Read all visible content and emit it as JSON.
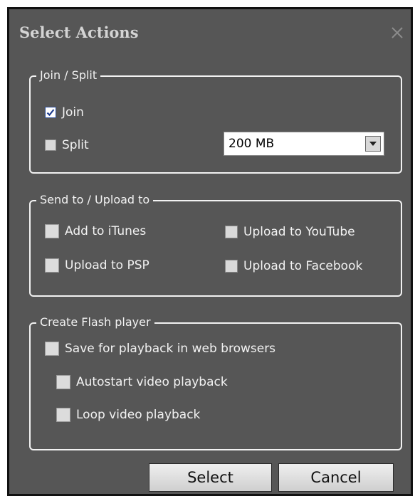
{
  "dialog": {
    "title": "Select Actions",
    "close_icon": "close-icon"
  },
  "join_split": {
    "legend": "Join / Split",
    "join": {
      "label": "Join",
      "checked": true
    },
    "split": {
      "label": "Split",
      "checked": false
    },
    "size_select": {
      "value": "200 MB"
    }
  },
  "send_upload": {
    "legend": "Send to / Upload to",
    "itunes": {
      "label": "Add to iTunes",
      "checked": false
    },
    "youtube": {
      "label": "Upload to YouTube",
      "checked": false
    },
    "psp": {
      "label": "Upload to PSP",
      "checked": false
    },
    "facebook": {
      "label": "Upload to Facebook",
      "checked": false
    }
  },
  "flash": {
    "legend": "Create Flash player",
    "save_web": {
      "label": "Save for playback in web browsers",
      "checked": false
    },
    "autostart": {
      "label": "Autostart video playback",
      "checked": false
    },
    "loop": {
      "label": "Loop video playback",
      "checked": false
    }
  },
  "buttons": {
    "select": "Select",
    "cancel": "Cancel"
  }
}
